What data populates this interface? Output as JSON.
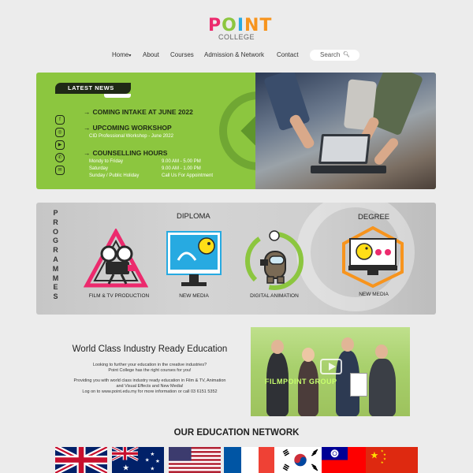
{
  "logo": {
    "p1": "P",
    "p2": "O",
    "p3": "I",
    "p4": "NT",
    "sub": "COLLEGE"
  },
  "nav": {
    "items": [
      "Home",
      "About",
      "Courses",
      "Admission & Network",
      "Contact"
    ],
    "search_placeholder": "Search"
  },
  "colors": {
    "accent_green": "#8cc63f",
    "dark_green": "#1f2a16",
    "pink": "#ec2a6d",
    "blue": "#27aae1",
    "orange": "#f7941d"
  },
  "news": {
    "tab_label": "LATEST NEWS",
    "social_icons": [
      "facebook-icon",
      "instagram-icon",
      "youtube-icon",
      "whatsapp-icon",
      "wechat-icon"
    ],
    "items": [
      {
        "heading": "COMING INTAKE AT JUNE 2022"
      },
      {
        "heading": "UPCOMING WORKSHOP",
        "sub": "CID Professional Workshop - June 2022"
      },
      {
        "heading": "COUNSELLING HOURS",
        "hours": [
          {
            "day": "Mondy to Friday",
            "time": "9.00 AM - 5.00 PM"
          },
          {
            "day": "Saturday",
            "time": "9.00 AM - 1.00 PM"
          },
          {
            "day": "Sunday / Public Holiday",
            "time": "Call Us For Appointment"
          }
        ]
      }
    ]
  },
  "programmes": {
    "vertical_label": "PROGRAMMES",
    "diploma_title": "DIPLOMA",
    "degree_title": "DEGREE",
    "courses": [
      "FILM & TV PRODUCTION",
      "NEW MEDIA",
      "DIGITAL ANIMATION",
      "NEW MEDIA"
    ]
  },
  "world_class": {
    "title": "World Class Industry Ready Education",
    "line1": "Looking to further your education in the creative industries?",
    "line2": "Point College has the right courses for you!",
    "line3": "Providing you with world class industry ready education in Film & TV, Animation",
    "line4": "and Visual Effects and New Media!",
    "line5": "Log on to www.point.edu.my for more information or call 03 6151 5352",
    "photo_caption": "FILMPOINT GROUP"
  },
  "network": {
    "title": "OUR EDUCATION NETWORK",
    "flags": [
      "uk-flag-icon",
      "australia-flag-icon",
      "usa-flag-icon",
      "france-flag-icon",
      "korea-flag-icon",
      "taiwan-flag-icon",
      "china-flag-icon"
    ]
  }
}
